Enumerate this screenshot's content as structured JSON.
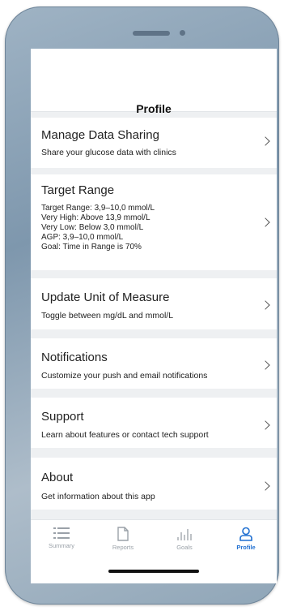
{
  "header": {
    "title": "Profile"
  },
  "items": [
    {
      "title": "Manage Data Sharing",
      "subtitle": "Share your glucose data with clinics"
    },
    {
      "title": "Target Range",
      "lines": [
        "Target Range: 3,9–10,0 mmol/L",
        "Very High: Above 13,9 mmol/L",
        "Very Low: Below 3,0 mmol/L",
        "AGP: 3,9–10,0 mmol/L",
        "Goal: Time in Range is 70%"
      ]
    },
    {
      "title": "Update Unit of Measure",
      "subtitle": "Toggle between mg/dL and mmol/L"
    },
    {
      "title": "Notifications",
      "subtitle": "Customize your push and email notifications"
    },
    {
      "title": "Support",
      "subtitle": "Learn about features or contact tech support"
    },
    {
      "title": "About",
      "subtitle": "Get information about this app"
    }
  ],
  "tabs": [
    {
      "label": "Summary",
      "icon": "list-icon",
      "active": false
    },
    {
      "label": "Reports",
      "icon": "document-icon",
      "active": false
    },
    {
      "label": "Goals",
      "icon": "bar-chart-icon",
      "active": false
    },
    {
      "label": "Profile",
      "icon": "person-icon",
      "active": true
    }
  ],
  "colors": {
    "accent": "#1f6fd1",
    "background": "#eef0f2",
    "inactive_tab": "#9aa1a8"
  }
}
